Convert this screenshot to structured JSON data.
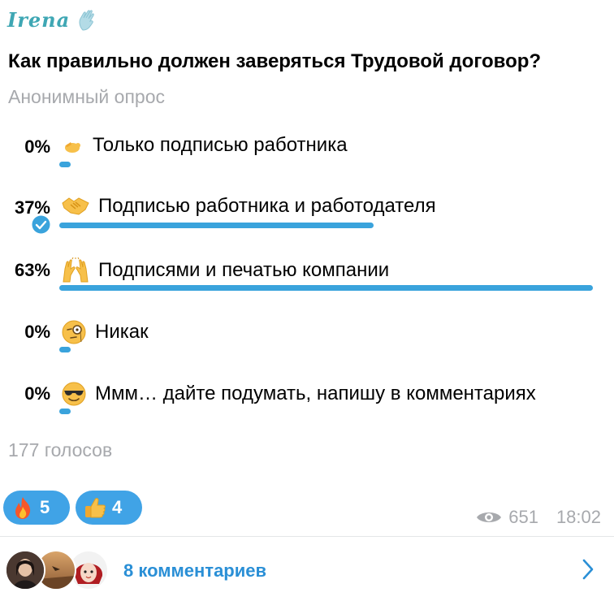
{
  "author": {
    "name": "Irena",
    "icon": "waving-hand-icon"
  },
  "question": "Как правильно должен заверяться Трудовой договор?",
  "poll_type": "Анонимный опрос",
  "options": [
    {
      "percent": "0%",
      "value": 0,
      "emoji": "pinching-hand-emoji",
      "label": "Только подписью работника",
      "selected": false
    },
    {
      "percent": "37%",
      "value": 37,
      "emoji": "handshake-emoji",
      "label": "Подписью работника и работодателя",
      "selected": true
    },
    {
      "percent": "63%",
      "value": 63,
      "emoji": "raising-hands-emoji",
      "label": "Подписями и печатью компании",
      "selected": false
    },
    {
      "percent": "0%",
      "value": 0,
      "emoji": "monocle-face-emoji",
      "label": "Никак",
      "selected": false
    },
    {
      "percent": "0%",
      "value": 0,
      "emoji": "sunglasses-face-emoji",
      "label": "Ммм… дайте подумать, напишу в комментариях",
      "selected": false
    }
  ],
  "votes": "177 голосов",
  "reactions": [
    {
      "emoji": "fire-emoji",
      "count": "5"
    },
    {
      "emoji": "thumbs-up-emoji",
      "count": "4"
    }
  ],
  "views": "651",
  "time": "18:02",
  "comments": {
    "label": "8 комментариев"
  },
  "colors": {
    "accent": "#3aa3dc",
    "muted": "#a7a9ad",
    "link": "#2a8fd6",
    "author": "#3fa7b4"
  }
}
